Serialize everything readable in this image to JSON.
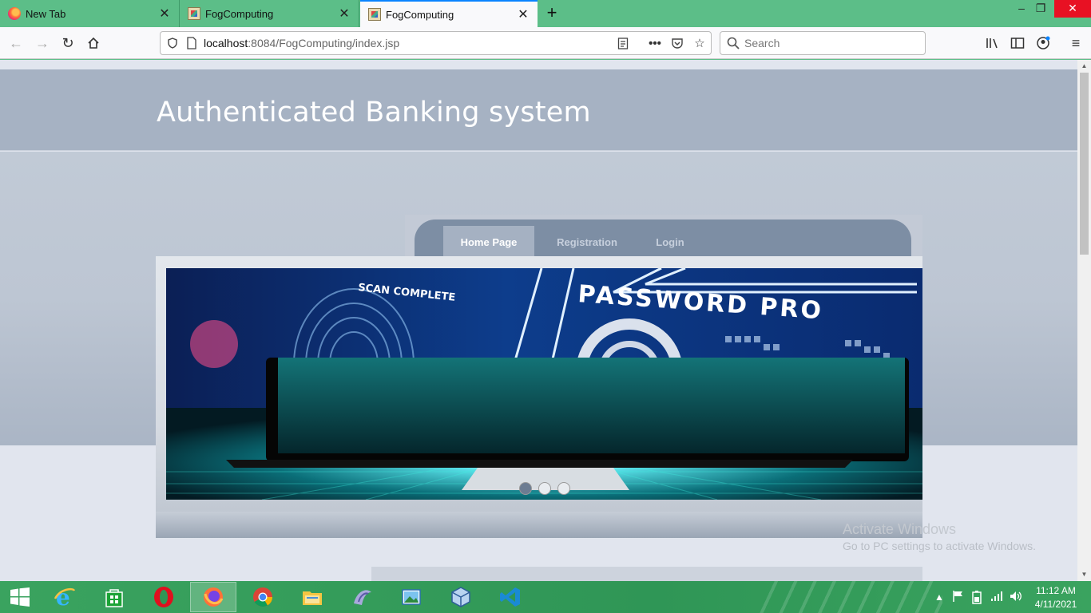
{
  "browser": {
    "tabs": [
      {
        "title": "New Tab",
        "icon": "firefox-icon"
      },
      {
        "title": "FogComputing",
        "icon": "page-icon"
      },
      {
        "title": "FogComputing",
        "icon": "page-icon",
        "active": true
      }
    ],
    "url_host": "localhost",
    "url_rest": ":8084/FogComputing/index.jsp",
    "search_placeholder": "Search"
  },
  "page": {
    "site_title": "Authenticated Banking system",
    "menu": [
      {
        "label": "Home Page",
        "active": true
      },
      {
        "label": "Registration"
      },
      {
        "label": "Login"
      }
    ],
    "slide_text": {
      "scan": "SCAN COMPLETE",
      "password": "PASSWORD PRO"
    },
    "slider_dot_count": 3,
    "activate_title": "Activate Windows",
    "activate_subtitle": "Go to PC settings to activate Windows."
  },
  "taskbar": {
    "apps": [
      "internet-explorer-icon",
      "store-icon",
      "opera-icon",
      "firefox-icon",
      "chrome-icon",
      "file-explorer-icon",
      "netbeans-icon",
      "photos-icon",
      "box-icon",
      "vscode-icon"
    ],
    "clock_time": "11:12 AM",
    "clock_date": "4/11/2021"
  },
  "colors": {
    "header_band": "#a6b2c3",
    "menu_bar": "#7d8ea4",
    "taskbar": "#2f9656",
    "tab_bar": "#5cbe88"
  }
}
